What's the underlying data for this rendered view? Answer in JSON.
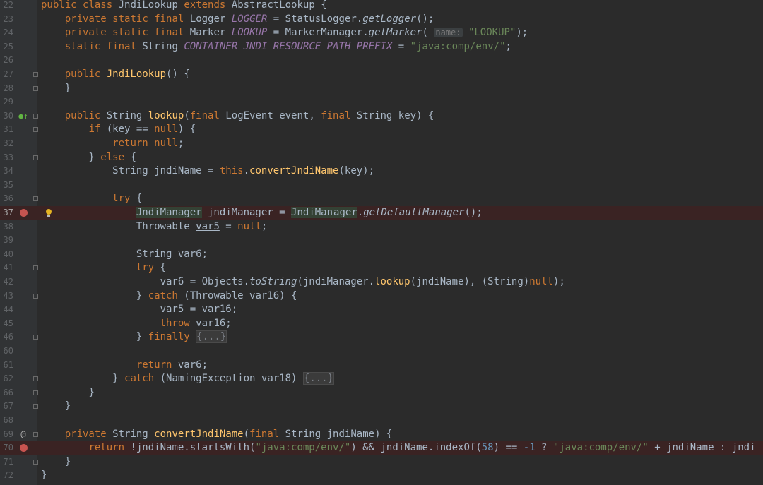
{
  "editor": {
    "colors": {
      "background": "#2b2b2b",
      "gutter": "#313335",
      "breakpoint": "#c75450",
      "breakpoint_line": "#3a2323",
      "keyword": "#cc7832",
      "method": "#ffc66d",
      "static_field": "#9876aa",
      "string": "#6a8759",
      "number": "#6897bb",
      "text": "#a9b7c6"
    },
    "lines": [
      {
        "num": "22",
        "text": "public class JndiLookup extends AbstractLookup {"
      },
      {
        "num": "23",
        "text": "    private static final Logger LOGGER = StatusLogger.getLogger();"
      },
      {
        "num": "24",
        "text": "    private static final Marker LOOKUP = MarkerManager.getMarker( name: \"LOOKUP\");",
        "hint": "name:"
      },
      {
        "num": "25",
        "text": "    static final String CONTAINER_JNDI_RESOURCE_PATH_PREFIX = \"java:comp/env/\";"
      },
      {
        "num": "26",
        "text": ""
      },
      {
        "num": "27",
        "text": "    public JndiLookup() {"
      },
      {
        "num": "28",
        "text": "    }"
      },
      {
        "num": "29",
        "text": ""
      },
      {
        "num": "30",
        "text": "    public String lookup(final LogEvent event, final String key) {",
        "gutter_icons": [
          "override-icon"
        ]
      },
      {
        "num": "31",
        "text": "        if (key == null) {"
      },
      {
        "num": "32",
        "text": "            return null;"
      },
      {
        "num": "33",
        "text": "        } else {"
      },
      {
        "num": "34",
        "text": "            String jndiName = this.convertJndiName(key);"
      },
      {
        "num": "35",
        "text": ""
      },
      {
        "num": "36",
        "text": "            try {"
      },
      {
        "num": "37",
        "text": "                JndiManager jndiManager = JndiManager.getDefaultManager();",
        "breakpoint": true,
        "current": true,
        "gutter_icons": [
          "breakpoint-icon",
          "lightbulb-icon"
        ]
      },
      {
        "num": "38",
        "text": "                Throwable var5 = null;"
      },
      {
        "num": "39",
        "text": ""
      },
      {
        "num": "40",
        "text": "                String var6;"
      },
      {
        "num": "41",
        "text": "                try {"
      },
      {
        "num": "42",
        "text": "                    var6 = Objects.toString(jndiManager.lookup(jndiName), (String)null);"
      },
      {
        "num": "43",
        "text": "                } catch (Throwable var16) {"
      },
      {
        "num": "44",
        "text": "                    var5 = var16;"
      },
      {
        "num": "45",
        "text": "                    throw var16;"
      },
      {
        "num": "46",
        "text": "                } finally {...}",
        "folded": "{...}"
      },
      {
        "num": "60",
        "text": ""
      },
      {
        "num": "61",
        "text": "                return var6;"
      },
      {
        "num": "62",
        "text": "            } catch (NamingException var18) {...}",
        "folded": "{...}"
      },
      {
        "num": "66",
        "text": "        }"
      },
      {
        "num": "67",
        "text": "    }"
      },
      {
        "num": "68",
        "text": ""
      },
      {
        "num": "69",
        "text": "    private String convertJndiName(final String jndiName) {",
        "gutter_icons": [
          "annotation-icon"
        ]
      },
      {
        "num": "70",
        "text": "        return !jndiName.startsWith(\"java:comp/env/\") && jndiName.indexOf(58) == -1 ? \"java:comp/env/\" + jndiName : jndi",
        "breakpoint": true,
        "gutter_icons": [
          "breakpoint-icon"
        ]
      },
      {
        "num": "71",
        "text": "    }"
      },
      {
        "num": "72",
        "text": "}"
      }
    ]
  }
}
